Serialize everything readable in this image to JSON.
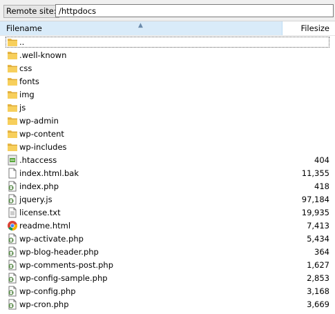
{
  "sitebar": {
    "label": "Remote site:",
    "path": "/httpdocs"
  },
  "header": {
    "filename": "Filename",
    "filesize": "Filesize"
  },
  "files": [
    {
      "name": "..",
      "size": "",
      "icon": "folder-icon"
    },
    {
      "name": ".well-known",
      "size": "",
      "icon": "folder-icon"
    },
    {
      "name": "css",
      "size": "",
      "icon": "folder-icon"
    },
    {
      "name": "fonts",
      "size": "",
      "icon": "folder-icon"
    },
    {
      "name": "img",
      "size": "",
      "icon": "folder-icon"
    },
    {
      "name": "js",
      "size": "",
      "icon": "folder-icon"
    },
    {
      "name": "wp-admin",
      "size": "",
      "icon": "folder-icon"
    },
    {
      "name": "wp-content",
      "size": "",
      "icon": "folder-icon"
    },
    {
      "name": "wp-includes",
      "size": "",
      "icon": "folder-icon"
    },
    {
      "name": ".htaccess",
      "size": "404",
      "icon": "htaccess-file-icon"
    },
    {
      "name": "index.html.bak",
      "size": "11,355",
      "icon": "blank-file-icon"
    },
    {
      "name": "index.php",
      "size": "418",
      "icon": "script-file-icon"
    },
    {
      "name": "jquery.js",
      "size": "97,184",
      "icon": "script-file-icon"
    },
    {
      "name": "license.txt",
      "size": "19,935",
      "icon": "text-file-icon"
    },
    {
      "name": "readme.html",
      "size": "7,413",
      "icon": "chrome-html-file-icon"
    },
    {
      "name": "wp-activate.php",
      "size": "5,434",
      "icon": "script-file-icon"
    },
    {
      "name": "wp-blog-header.php",
      "size": "364",
      "icon": "script-file-icon"
    },
    {
      "name": "wp-comments-post.php",
      "size": "1,627",
      "icon": "script-file-icon"
    },
    {
      "name": "wp-config-sample.php",
      "size": "2,853",
      "icon": "script-file-icon"
    },
    {
      "name": "wp-config.php",
      "size": "3,168",
      "icon": "script-file-icon"
    },
    {
      "name": "wp-cron.php",
      "size": "3,669",
      "icon": "script-file-icon"
    }
  ]
}
